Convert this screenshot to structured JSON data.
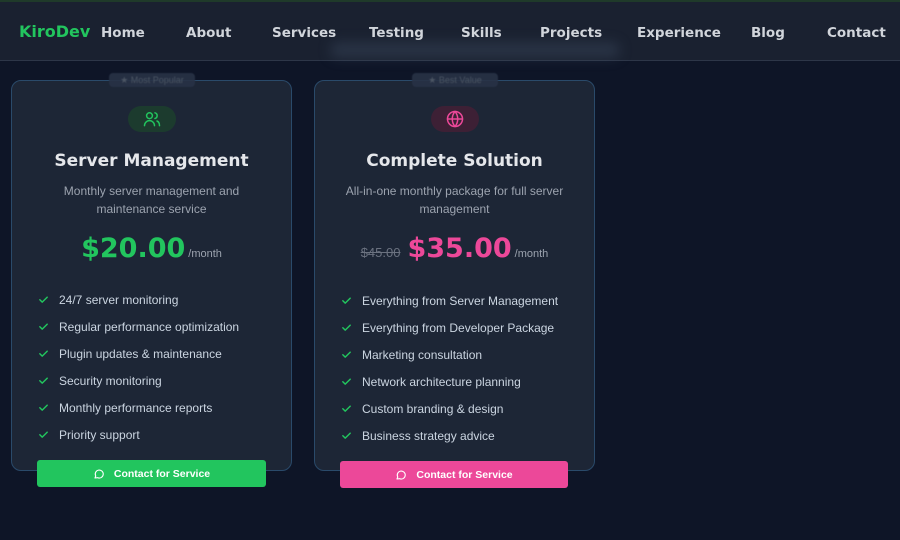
{
  "nav": {
    "brand": "KiroDev",
    "items": [
      "Home",
      "About",
      "Services",
      "Testing",
      "Skills",
      "Projects",
      "Experience",
      "Blog",
      "Contact"
    ]
  },
  "colors": {
    "green": "#22c55e",
    "pink": "#ec4899",
    "background": "#0e1527",
    "card": "#1d2636"
  },
  "cards": [
    {
      "badge": "★ Most Popular",
      "icon": "users-icon",
      "title": "Server Management",
      "description": "Monthly server management and maintenance service",
      "old_price": "",
      "price": "$20.00",
      "period": "/month",
      "features": [
        "24/7 server monitoring",
        "Regular performance optimization",
        "Plugin updates & maintenance",
        "Security monitoring",
        "Monthly performance reports",
        "Priority support"
      ],
      "cta": "Contact for Service"
    },
    {
      "badge": "★ Best Value",
      "icon": "globe-icon",
      "title": "Complete Solution",
      "description": "All-in-one monthly package for full server management",
      "old_price": "$45.00",
      "price": "$35.00",
      "period": "/month",
      "features": [
        "Everything from Server Management",
        "Everything from Developer Package",
        "Marketing consultation",
        "Network architecture planning",
        "Custom branding & design",
        "Business strategy advice"
      ],
      "cta": "Contact for Service"
    }
  ]
}
